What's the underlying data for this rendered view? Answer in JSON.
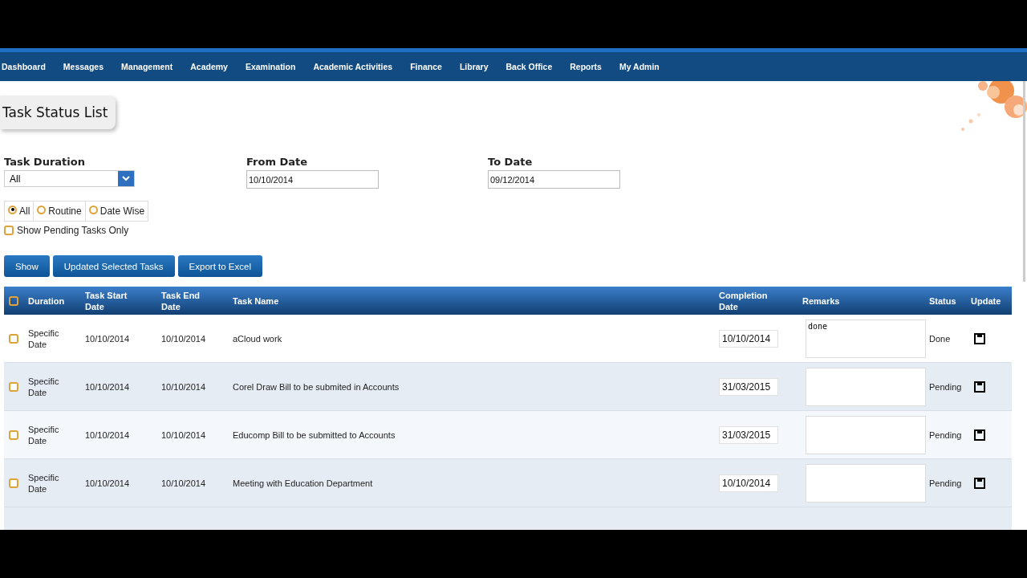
{
  "nav": {
    "items": [
      {
        "label": "Dashboard"
      },
      {
        "label": "Messages"
      },
      {
        "label": "Management"
      },
      {
        "label": "Academy"
      },
      {
        "label": "Examination"
      },
      {
        "label": "Academic Activities"
      },
      {
        "label": "Finance"
      },
      {
        "label": "Library"
      },
      {
        "label": "Back Office"
      },
      {
        "label": "Reports"
      },
      {
        "label": "My Admin"
      }
    ]
  },
  "page_title": "Task Status List",
  "filters": {
    "task_duration": {
      "label": "Task Duration",
      "value": "All"
    },
    "from_date": {
      "label": "From Date",
      "value": "10/10/2014"
    },
    "to_date": {
      "label": "To Date",
      "value": "09/12/2014"
    },
    "type_options": [
      {
        "label": "All",
        "selected": true
      },
      {
        "label": "Routine",
        "selected": false
      },
      {
        "label": "Date Wise",
        "selected": false
      }
    ],
    "pending_only": {
      "label": "Show Pending Tasks Only",
      "checked": false
    }
  },
  "buttons": [
    {
      "label": "Show"
    },
    {
      "label": "Updated Selected Tasks"
    },
    {
      "label": "Export to Excel"
    }
  ],
  "table": {
    "select_all_checked": false,
    "columns": [
      "Duration",
      "Task Start Date",
      "Task End Date",
      "Task Name",
      "Completion Date",
      "Remarks",
      "Status",
      "Update"
    ],
    "rows": [
      {
        "checked": false,
        "duration": "Specific Date",
        "start": "10/10/2014",
        "end": "10/10/2014",
        "task_name": "aCloud work",
        "completion_date": "10/10/2014",
        "remarks": "done",
        "status": "Done"
      },
      {
        "checked": false,
        "duration": "Specific Date",
        "start": "10/10/2014",
        "end": "10/10/2014",
        "task_name": "Corel Draw Bill to be submited in Accounts",
        "completion_date": "31/03/2015",
        "status": "Pending"
      },
      {
        "checked": false,
        "duration": "Specific Date",
        "start": "10/10/2014",
        "end": "10/10/2014",
        "task_name": "Educomp Bill to be submitted to Accounts",
        "completion_date": "31/03/2015",
        "status": "Pending"
      },
      {
        "checked": false,
        "duration": "Specific Date",
        "start": "10/10/2014",
        "end": "10/10/2014",
        "task_name": "Meeting with Education Department",
        "completion_date": "10/10/2014",
        "status": "Pending"
      }
    ]
  }
}
